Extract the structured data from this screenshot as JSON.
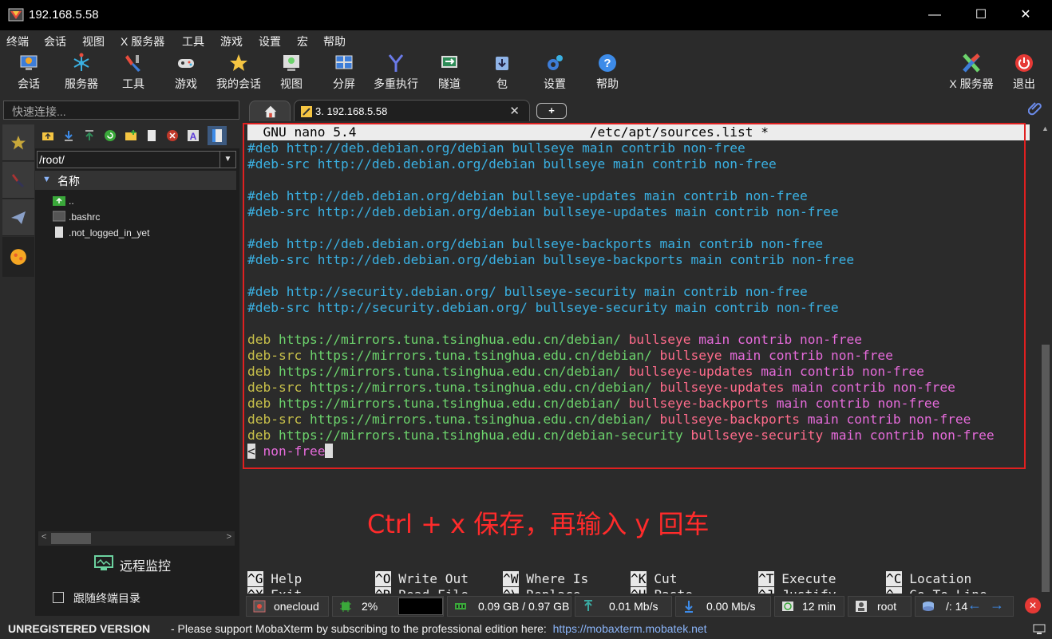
{
  "window": {
    "title": "192.168.5.58",
    "minimize": "—",
    "maximize": "☐",
    "close": "✕"
  },
  "menu": [
    "终端",
    "会话",
    "视图",
    "X 服务器",
    "工具",
    "游戏",
    "设置",
    "宏",
    "帮助"
  ],
  "toolbar": {
    "session": "会话",
    "servers": "服务器",
    "tools": "工具",
    "games": "游戏",
    "my_sessions": "我的会话",
    "view": "视图",
    "split": "分屏",
    "multiexec": "多重执行",
    "tunnel": "隧道",
    "packages": "包",
    "settings": "设置",
    "help": "帮助",
    "xserver": "X 服务器",
    "exit": "退出"
  },
  "quick_connect": {
    "placeholder": "快速连接..."
  },
  "tabs": {
    "session_title": "3. 192.168.5.58",
    "close": "✕",
    "new": "+"
  },
  "file_browser": {
    "path": "/root/",
    "header": "名称",
    "files": [
      "..",
      ".bashrc",
      ".not_logged_in_yet"
    ],
    "remote_monitor": "远程监控",
    "follow_terminal": "跟随终端目录"
  },
  "terminal": {
    "nano_header": "  GNU nano 5.4                              /etc/apt/sources.list *",
    "commented": [
      [
        "#deb http://deb.debian.org/debian bullseye main contrib non-free"
      ],
      [
        "#deb-src http://deb.debian.org/debian bullseye main contrib non-free"
      ],
      [
        ""
      ],
      [
        "#deb http://deb.debian.org/debian bullseye-updates main contrib non-free"
      ],
      [
        "#deb-src http://deb.debian.org/debian bullseye-updates main contrib non-free"
      ],
      [
        ""
      ],
      [
        "#deb http://deb.debian.org/debian bullseye-backports main contrib non-free"
      ],
      [
        "#deb-src http://deb.debian.org/debian bullseye-backports main contrib non-free"
      ],
      [
        ""
      ],
      [
        "#deb http://security.debian.org/ bullseye-security main contrib non-free"
      ],
      [
        "#deb-src http://security.debian.org/ bullseye-security main contrib non-free"
      ],
      [
        ""
      ]
    ],
    "active_lines": [
      {
        "type": "deb",
        "url": "https://mirrors.tuna.tsinghua.edu.cn/debian/",
        "suite": "bullseye",
        "components": "main contrib non-free"
      },
      {
        "type": "deb-src",
        "url": "https://mirrors.tuna.tsinghua.edu.cn/debian/",
        "suite": "bullseye",
        "components": "main contrib non-free"
      },
      {
        "type": "deb",
        "url": "https://mirrors.tuna.tsinghua.edu.cn/debian/",
        "suite": "bullseye-updates",
        "components": "main contrib non-free"
      },
      {
        "type": "deb-src",
        "url": "https://mirrors.tuna.tsinghua.edu.cn/debian/",
        "suite": "bullseye-updates",
        "components": "main contrib non-free"
      },
      {
        "type": "deb",
        "url": "https://mirrors.tuna.tsinghua.edu.cn/debian/",
        "suite": "bullseye-backports",
        "components": "main contrib non-free"
      },
      {
        "type": "deb-src",
        "url": "https://mirrors.tuna.tsinghua.edu.cn/debian/",
        "suite": "bullseye-backports",
        "components": "main contrib non-free"
      },
      {
        "type": "deb",
        "url": "https://mirrors.tuna.tsinghua.edu.cn/debian-security",
        "suite": "bullseye-security",
        "components": "main contrib non-free"
      }
    ],
    "wrap_prefix": "<",
    "wrap_text": " non-free",
    "annotation": "Ctrl + x 保存，再输入 y 回车",
    "shortcuts_row1": [
      {
        "key": "^G",
        "label": " Help"
      },
      {
        "key": "^O",
        "label": " Write Out"
      },
      {
        "key": "^W",
        "label": " Where Is"
      },
      {
        "key": "^K",
        "label": " Cut"
      },
      {
        "key": "^T",
        "label": " Execute"
      },
      {
        "key": "^C",
        "label": " Location"
      }
    ],
    "shortcuts_row2": [
      {
        "key": "^X",
        "label": " Exit"
      },
      {
        "key": "^R",
        "label": " Read File"
      },
      {
        "key": "^\\",
        "label": " Replace"
      },
      {
        "key": "^U",
        "label": " Paste"
      },
      {
        "key": "^J",
        "label": " Justify"
      },
      {
        "key": "^_",
        "label": " Go To Line"
      }
    ]
  },
  "status": {
    "host": "onecloud",
    "cpu": "2%",
    "memory": "0.09 GB / 0.97 GB",
    "upload": "0.01 Mb/s",
    "download": "0.00 Mb/s",
    "uptime": "12 min",
    "user": "root",
    "disk": "/: 14"
  },
  "footer": {
    "unregistered": "UNREGISTERED VERSION",
    "message": "-  Please support MobaXterm by subscribing to the professional edition here:",
    "link": "https://mobaxterm.mobatek.net"
  },
  "colors": {
    "comment": "#3ab0e2",
    "deb": "#c8c04a",
    "url": "#6cd36c",
    "suite": "#ff6b8b",
    "components": "#e66bdb",
    "annotation": "#ff2b2b",
    "highlight_box": "#e02020"
  }
}
